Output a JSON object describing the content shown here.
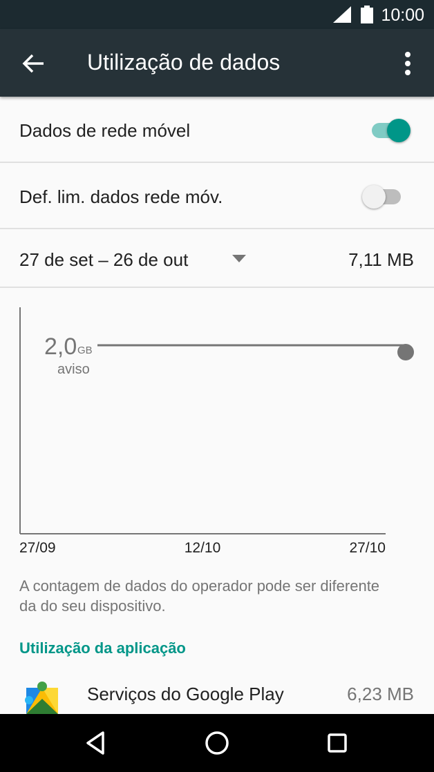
{
  "status_bar": {
    "time": "10:00",
    "icons": [
      "cellular-signal-icon",
      "battery-icon"
    ]
  },
  "app_bar": {
    "title": "Utilização de dados",
    "back_icon": "arrow-back-icon",
    "menu_icon": "more-vert-icon"
  },
  "settings": {
    "mobile_data": {
      "label": "Dados de rede móvel",
      "enabled": true
    },
    "data_limit": {
      "label": "Def. lim. dados rede móv.",
      "enabled": false
    }
  },
  "usage_cycle": {
    "period": "27 de set – 26 de out",
    "total": "7,11 MB"
  },
  "chart_data": {
    "type": "line",
    "x_ticks": [
      "27/09",
      "12/10",
      "27/10"
    ],
    "warning": {
      "value": "2,0",
      "unit": "GB",
      "label": "aviso"
    }
  },
  "note": "A contagem de dados do operador pode ser diferente da do seu dispositivo.",
  "app_usage": {
    "header": "Utilização da aplicação",
    "items": [
      {
        "name": "Serviços do Google Play",
        "usage": "6,23 MB",
        "icon": "google-play-services-icon"
      }
    ]
  },
  "colors": {
    "accent": "#009688",
    "app_bar": "#263238",
    "status_bar": "#1c2a30"
  }
}
